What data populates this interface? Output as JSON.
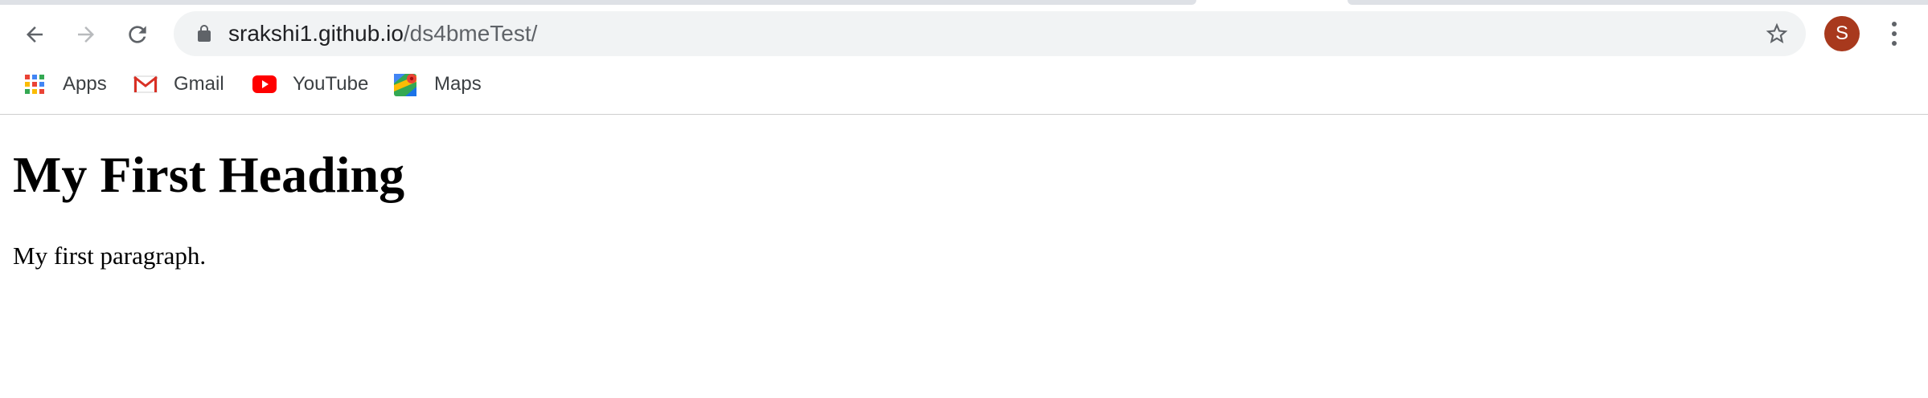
{
  "browser": {
    "address_bar": {
      "host": "srakshi1.github.io",
      "path": "/ds4bmeTest/"
    },
    "profile": {
      "initial": "S",
      "color": "#a8391d"
    },
    "toolbar_icons": [
      "back-arrow-icon",
      "forward-arrow-icon",
      "reload-icon",
      "lock-icon",
      "star-icon",
      "more-vert-icon"
    ]
  },
  "bookmarks": {
    "apps": "Apps",
    "gmail": "Gmail",
    "youtube": "YouTube",
    "maps": "Maps"
  },
  "page": {
    "heading": "My First Heading",
    "paragraph": "My first paragraph."
  },
  "colors": {
    "omnibox_bg": "#f1f3f4",
    "youtube_red": "#ff0000",
    "gmail_red": "#d93025"
  }
}
